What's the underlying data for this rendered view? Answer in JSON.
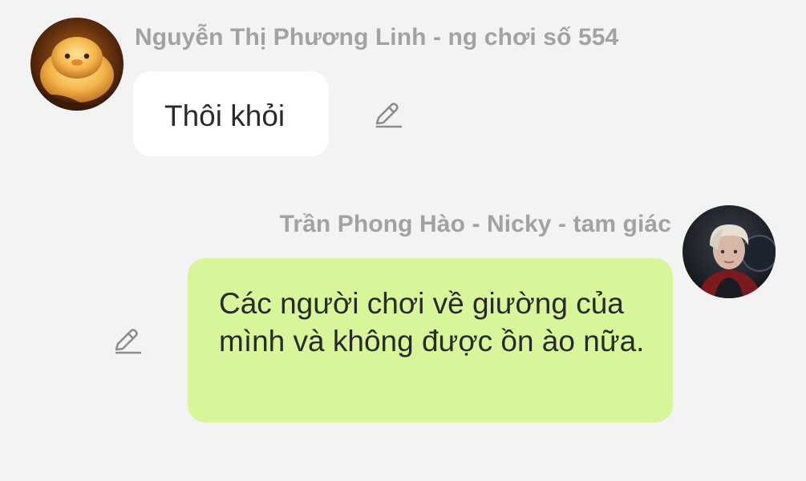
{
  "messages": [
    {
      "sender": "Nguyễn Thị Phương Linh - ng chơi số 554",
      "text": "Thôi khỏi",
      "direction": "incoming",
      "avatar": "yellow-duck-avatar"
    },
    {
      "sender": "Trần Phong Hào - Nicky - tam giác",
      "text": "Các người chơi về giường của mình và không được ồn ào nữa.",
      "direction": "outgoing",
      "avatar": "young-man-photo-avatar"
    }
  ],
  "colors": {
    "background": "#f3f3f3",
    "incoming_bubble": "#ffffff",
    "outgoing_bubble": "#d7f69a",
    "sender_name": "#a2a2a2",
    "message_text": "#2a2a2a",
    "icon": "#8c8c8c"
  },
  "icons": {
    "edit": "pencil-edit-icon"
  }
}
